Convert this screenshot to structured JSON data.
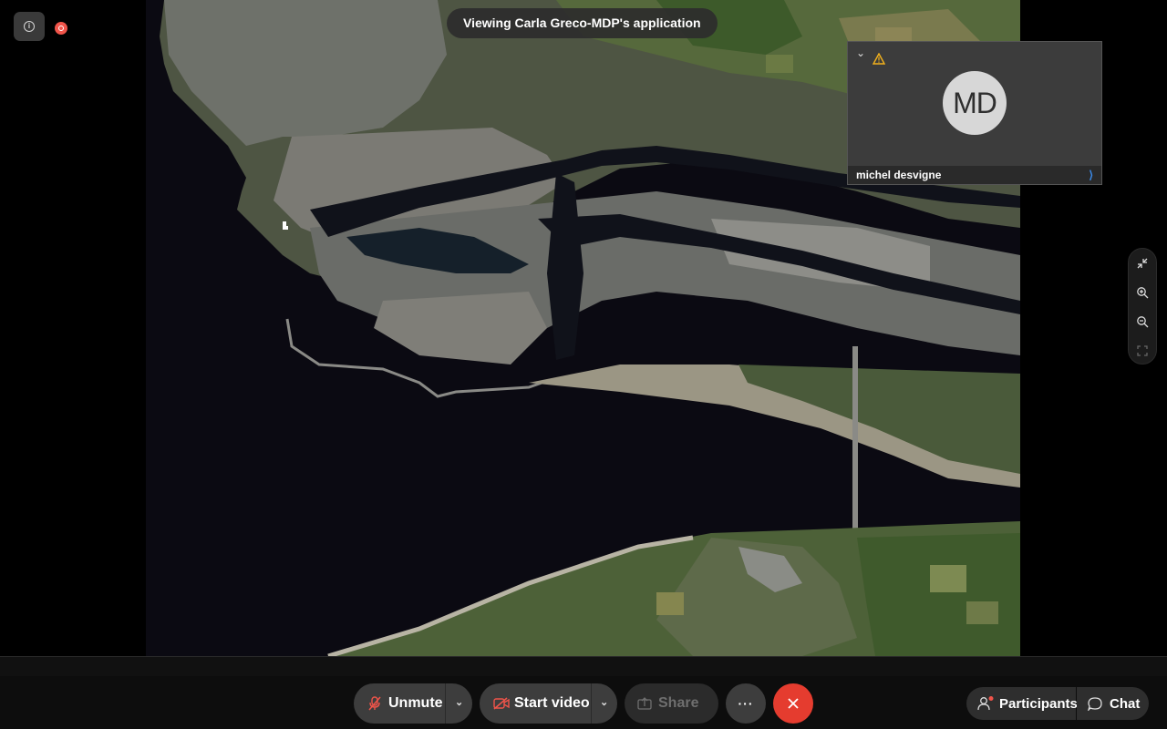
{
  "share_banner": "Viewing Carla Greco-MDP's application",
  "video_tile": {
    "initials": "MD",
    "name": "michel desvigne",
    "signal": "⟩"
  },
  "toolbar": {
    "unmute_label": "Unmute",
    "start_video_label": "Start video",
    "share_label": "Share",
    "more_label": "···",
    "participants_label": "Participants",
    "chat_label": "Chat"
  },
  "colors": {
    "record": "#f0544a",
    "leave": "#e53c2f",
    "video_off": "#f0544a",
    "name_accent": "#3b8ced",
    "warning": "#f3b21c"
  },
  "icons": {
    "info": "info-icon",
    "record": "record-icon",
    "collapse": "chevron-down-icon",
    "warning": "warning-icon",
    "exit_fullscreen": "exit-fullscreen-icon",
    "zoom_in": "zoom-in-icon",
    "zoom_out": "zoom-out-icon",
    "fit": "fit-screen-icon",
    "mic_muted": "mic-muted-icon",
    "video_off": "video-off-icon",
    "share": "share-icon",
    "more": "more-icon",
    "leave": "close-icon",
    "participants": "people-icon",
    "chat": "chat-icon"
  }
}
